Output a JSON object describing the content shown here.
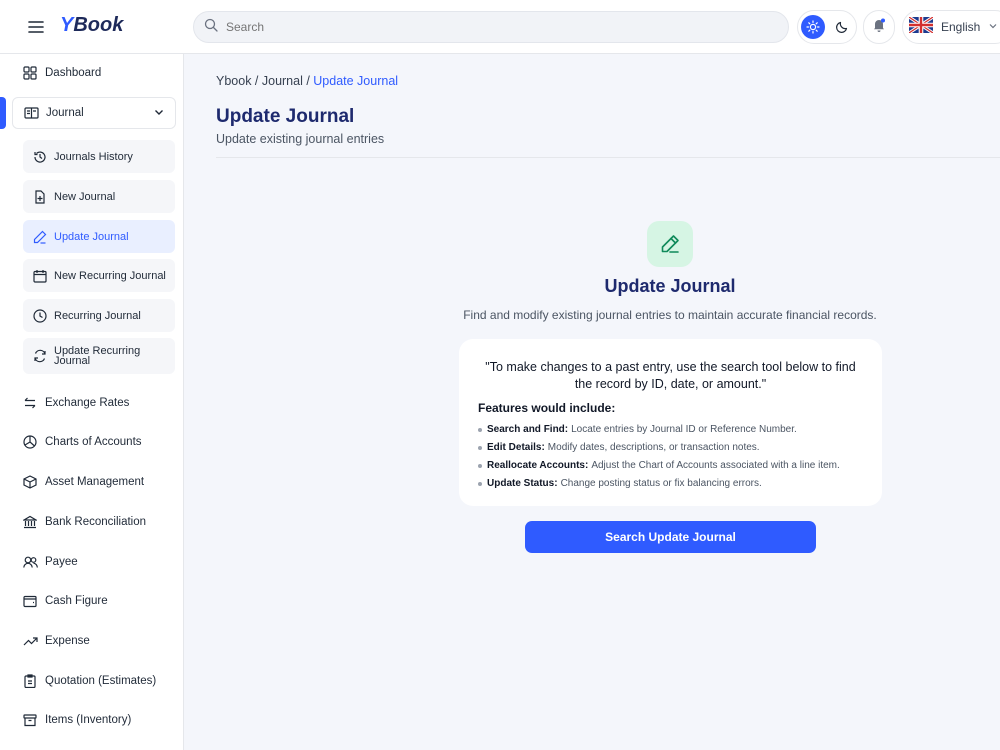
{
  "app": {
    "logo_y": "Y",
    "logo_rest": "Book"
  },
  "header": {
    "search_placeholder": "Search",
    "language": "English"
  },
  "sidebar": {
    "dashboard": "Dashboard",
    "journal": "Journal",
    "journal_sub": [
      {
        "label": "Journals History",
        "icon": "history-icon"
      },
      {
        "label": "New Journal",
        "icon": "file-plus-icon"
      },
      {
        "label": "Update Journal",
        "icon": "pencil-icon",
        "active": true
      },
      {
        "label": "New Recurring Journal",
        "icon": "calendar-icon"
      },
      {
        "label": "Recurring Journal",
        "icon": "clock-icon"
      },
      {
        "label": "Update Recurring Journal",
        "icon": "refresh-icon"
      }
    ],
    "items": [
      {
        "label": "Exchange Rates",
        "icon": "exchange-icon"
      },
      {
        "label": "Charts of Accounts",
        "icon": "pie-chart-icon"
      },
      {
        "label": "Asset Management",
        "icon": "box-icon"
      },
      {
        "label": "Bank Reconciliation",
        "icon": "bank-icon"
      },
      {
        "label": "Payee",
        "icon": "users-icon"
      },
      {
        "label": "Cash Figure",
        "icon": "wallet-icon"
      },
      {
        "label": "Expense",
        "icon": "trending-up-icon"
      },
      {
        "label": "Quotation (Estimates)",
        "icon": "clipboard-icon"
      },
      {
        "label": "Items (Inventory)",
        "icon": "archive-icon"
      }
    ]
  },
  "breadcrumb": {
    "part1": "Ybook / Journal / ",
    "current": "Update Journal"
  },
  "page": {
    "title": "Update Journal",
    "subtitle": "Update existing journal entries"
  },
  "hero": {
    "title": "Update Journal",
    "description": "Find and modify existing journal entries to maintain accurate financial records.",
    "quote": "\"To make changes to a past entry, use the search tool below to find the record by ID, date, or amount.\"",
    "features_title": "Features would include:",
    "features": [
      {
        "label": "Search and Find:",
        "text": "Locate entries by Journal ID or Reference Number."
      },
      {
        "label": "Edit Details:",
        "text": "Modify dates, descriptions, or transaction notes."
      },
      {
        "label": "Reallocate Accounts:",
        "text": "Adjust the Chart of Accounts associated with a line item."
      },
      {
        "label": "Update Status:",
        "text": "Change posting status or fix balancing errors."
      }
    ],
    "cta": "Search Update Journal"
  },
  "colors": {
    "accent": "#2f5bff",
    "title": "#1e2a6e",
    "hero_icon_bg": "#d6f5e4"
  }
}
